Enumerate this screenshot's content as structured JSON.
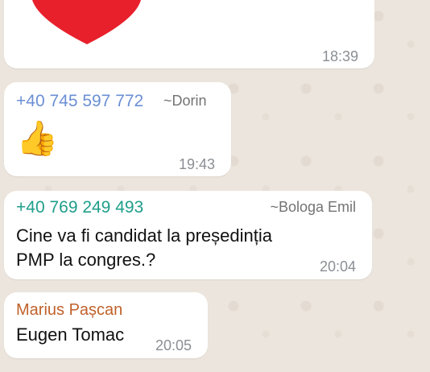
{
  "messages": [
    {
      "kind": "sticker",
      "emoji": "heart",
      "time": "18:39"
    },
    {
      "kind": "emoji",
      "phone": "+40 745 597 772",
      "alias": "~Dorin",
      "phone_color": "#6b8fd4",
      "emoji": "👍",
      "time": "19:43"
    },
    {
      "kind": "text",
      "phone": "+40 769 249 493",
      "alias": "~Bologa Emil",
      "phone_color": "#1f9e8a",
      "text_line1": "Cine va fi candidat la președinția",
      "text_line2": "PMP la congres.?",
      "time": "20:04"
    },
    {
      "kind": "text",
      "name": "Marius Pașcan",
      "name_color": "#c0612b",
      "text": "Eugen Tomac",
      "time": "20:05"
    }
  ],
  "colors": {
    "background": "#ece5dd",
    "bubble": "#ffffff",
    "heart": "#e8202b",
    "timestamp": "#8a8f94"
  }
}
